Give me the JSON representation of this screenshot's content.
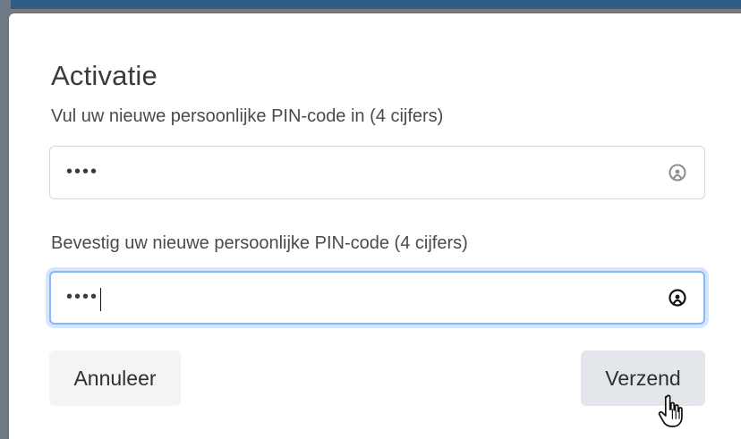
{
  "dialog": {
    "title": "Activatie",
    "field1": {
      "label": "Vul uw nieuwe persoonlijke PIN-code in (4 cijfers)",
      "masked_value": "••••",
      "icon": "password-manager-icon"
    },
    "field2": {
      "label": "Bevestig uw nieuwe persoonlijke PIN-code (4 cijfers)",
      "masked_value": "••••",
      "icon": "password-manager-icon"
    },
    "buttons": {
      "cancel_label": "Annuleer",
      "submit_label": "Verzend"
    }
  },
  "colors": {
    "title_text": "#3b3b3b",
    "label_text": "#4a4a4a",
    "focus_border": "#86b7fe",
    "submit_bg": "#e3e6ea",
    "cancel_bg": "#f4f4f4",
    "backdrop": "#7a7a7a"
  }
}
